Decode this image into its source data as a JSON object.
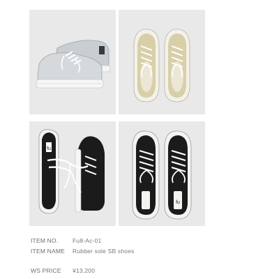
{
  "photos": [
    {
      "name": "silver-shoes-photo",
      "colorway": "silver"
    },
    {
      "name": "gold-shoes-photo",
      "colorway": "gold"
    },
    {
      "name": "black-shoes-side-photo",
      "colorway": "black"
    },
    {
      "name": "black-shoes-top-photo",
      "colorway": "black"
    }
  ],
  "item": {
    "no_label": "ITEM NO.",
    "no_value": "Fu8-Ac-01",
    "name_label": "ITEM NAME",
    "name_value": "Rubber sole SB shoes",
    "price_label": "WS PRICE",
    "price_value": "¥13,200"
  },
  "colors": {
    "background": "#ffffff",
    "photo_bg": "#e9e9e9",
    "text": "#6d6d6d",
    "silver": "#cfd3d6",
    "gold": "#d8cfa8",
    "black": "#1b1b1b"
  }
}
